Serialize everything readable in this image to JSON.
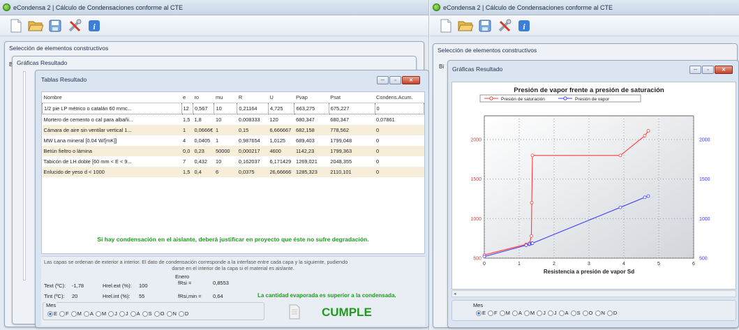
{
  "left": {
    "title": "eCondensa 2 | Cálculo de Condensaciones conforme al CTE",
    "sel_title": "Selección de elementos constructivos",
    "graf_title": "Gráficas Resultado",
    "tablas": {
      "title": "Tablas Resultado",
      "headers": [
        "Nombre",
        "e",
        "ro",
        "mu",
        "R",
        "U",
        "Pvap",
        "Psat",
        "Condens.Acum."
      ],
      "rows": [
        [
          "1/2 pie LP métrico o catalán 60 mmc...",
          "12",
          "0,567",
          "10",
          "0,21164",
          "4,725",
          "663,275",
          "675,227",
          "0"
        ],
        [
          "Mortero de cemento o cal para albañi...",
          "1,5",
          "1,8",
          "10",
          "0,008333",
          "120",
          "680,347",
          "680,347",
          "0,07861"
        ],
        [
          "Cámara de aire sin ventilar vertical 1...",
          "1",
          "0,0666€",
          "1",
          "0,15",
          "6,666667",
          "682,158",
          "778,562",
          "0"
        ],
        [
          "MW Lana mineral [0.04 W/[mK]]",
          "4",
          "0,0405",
          "1",
          "0,987654",
          "1,0125",
          "689,403",
          "1799,048",
          "0"
        ],
        [
          "Betún fieltro o lámina",
          "0,0",
          "0,23",
          "50000",
          "0,000217",
          "4600",
          "1142,23",
          "1799,363",
          "0"
        ],
        [
          "Tabicón de LH doble [60 mm < E < 9...",
          "7",
          "0,432",
          "10",
          "0,162037",
          "6,171429",
          "1269,021",
          "2048,355",
          "0"
        ],
        [
          "Enlucido de yeso d < 1000",
          "1,5",
          "0,4",
          "6",
          "0,0375",
          "26,66666",
          "1285,323",
          "2110,101",
          "0"
        ]
      ],
      "warning": "Si hay condensación en el aislante, deberá justificar en proyecto que éste no sufre degradación.",
      "note1": "Las capas se ordenan de exterior a interior. El dato de condensación corresponde a la interfase entre cada capa y la siguiente, pudiendo",
      "note2": "darse en el interior de la capa si el material es aislante.",
      "text_label": "Text (ºC):",
      "text_val": "-1,78",
      "hrel_ext_label": "Hrel.ext (%):",
      "hrel_ext_val": "100",
      "tint_label": "Tint (ºC):",
      "tint_val": "20",
      "hrel_int_label": "Hrel.int (%):",
      "hrel_int_val": "55",
      "month": "Enero",
      "frsi_label": "fRsi =",
      "frsi_val": "0,8553",
      "frsimin_label": "fRsi,min =",
      "frsimin_val": "0,64",
      "evap": "La cantidad evaporada es superior a la condensada.",
      "mes_label": "Mes",
      "months": [
        "E",
        "F",
        "M",
        "A",
        "M",
        "J",
        "J",
        "A",
        "S",
        "O",
        "N",
        "D"
      ],
      "result": "CUMPLE"
    }
  },
  "right": {
    "title": "eCondensa 2 | Cálculo de Condensaciones conforme al CTE",
    "sel_title": "Selección de elementos constructivos",
    "graf_title": "Gráficas Resultado",
    "mes_label": "Mes",
    "months": [
      "E",
      "F",
      "M",
      "A",
      "M",
      "J",
      "J",
      "A",
      "S",
      "O",
      "N",
      "D"
    ]
  },
  "colors": {
    "sat": "#ff3b3b",
    "vap": "#3b3bff",
    "warning": "#1e9b1e",
    "cumple": "#1e9b1e"
  },
  "chart_data": {
    "type": "line",
    "title": "Presión de vapor frente a presión de saturación",
    "xlabel": "Resistencia a presión de vapor Sd",
    "ylabel": "",
    "xlim": [
      0,
      6
    ],
    "ylim": [
      500,
      2300
    ],
    "xticks": [
      "0",
      "1",
      "2",
      "3",
      "4",
      "5",
      "6"
    ],
    "yticks": [
      "500",
      "1000",
      "1500",
      "2000"
    ],
    "series": [
      {
        "name": "Presión de saturación",
        "color": "#ff3b3b",
        "x": [
          0,
          1.2,
          1.29,
          1.3,
          1.35,
          1.36,
          1.38,
          3.9,
          4.6,
          4.7
        ],
        "y": [
          540,
          675,
          680,
          690,
          780,
          1200,
          1799,
          1799,
          2048,
          2110
        ]
      },
      {
        "name": "Presión de vapor",
        "color": "#3b3bff",
        "x": [
          0,
          1.2,
          1.29,
          1.3,
          1.35,
          1.36,
          1.38,
          3.9,
          4.6,
          4.7
        ],
        "y": [
          520,
          663,
          675,
          680,
          685,
          688,
          689,
          1142,
          1269,
          1285
        ]
      }
    ]
  }
}
